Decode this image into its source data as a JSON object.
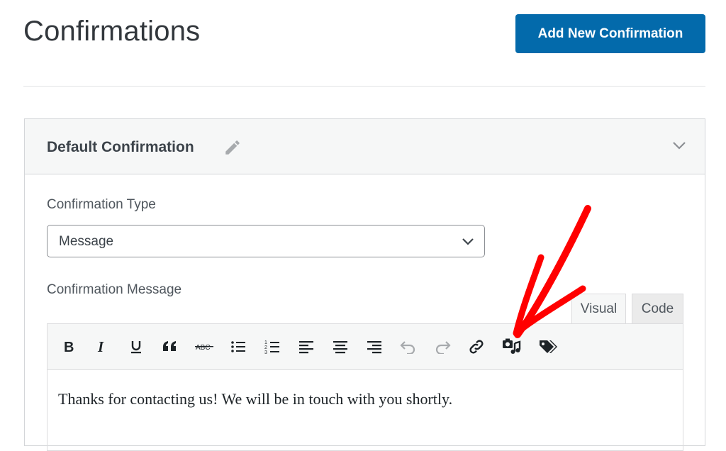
{
  "header": {
    "title": "Confirmations",
    "add_button": "Add New Confirmation"
  },
  "panel": {
    "title": "Default Confirmation",
    "type_label": "Confirmation Type",
    "type_value": "Message",
    "message_label": "Confirmation Message",
    "tabs": [
      "Visual",
      "Code"
    ],
    "toolbar": [
      "bold",
      "italic",
      "underline",
      "blockquote",
      "strikethrough",
      "bulleted-list",
      "numbered-list",
      "align-left",
      "align-center",
      "align-right",
      "undo",
      "redo",
      "link",
      "add-media",
      "smart-tags"
    ],
    "message_text": "Thanks for contacting us! We will be in touch with you shortly."
  },
  "colors": {
    "accent": "#036aab",
    "annotation": "#ff0000"
  }
}
